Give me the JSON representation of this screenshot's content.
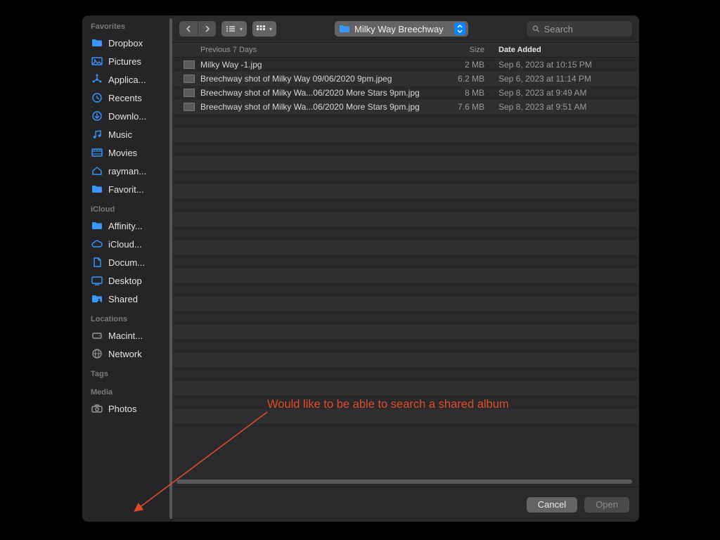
{
  "toolbar": {
    "current_folder": "Milky Way Breechway",
    "search_placeholder": "Search"
  },
  "columns": {
    "group_label": "Previous 7 Days",
    "size_label": "Size",
    "date_label": "Date Added"
  },
  "sidebar": {
    "sections": [
      {
        "title": "Favorites",
        "items": [
          {
            "icon": "folder",
            "label": "Dropbox"
          },
          {
            "icon": "picture",
            "label": "Pictures"
          },
          {
            "icon": "apps",
            "label": "Applica..."
          },
          {
            "icon": "clock",
            "label": "Recents"
          },
          {
            "icon": "download",
            "label": "Downlo..."
          },
          {
            "icon": "music",
            "label": "Music"
          },
          {
            "icon": "movie",
            "label": "Movies"
          },
          {
            "icon": "home",
            "label": "rayman..."
          },
          {
            "icon": "folder",
            "label": "Favorit..."
          }
        ]
      },
      {
        "title": "iCloud",
        "items": [
          {
            "icon": "folder",
            "label": "Affinity..."
          },
          {
            "icon": "cloud",
            "label": "iCloud..."
          },
          {
            "icon": "doc",
            "label": "Docum..."
          },
          {
            "icon": "desktop",
            "label": "Desktop"
          },
          {
            "icon": "shared",
            "label": "Shared"
          }
        ]
      },
      {
        "title": "Locations",
        "items": [
          {
            "icon": "disk",
            "label": "Macint...",
            "gray": true
          },
          {
            "icon": "globe",
            "label": "Network",
            "gray": true
          }
        ]
      },
      {
        "title": "Tags",
        "items": []
      },
      {
        "title": "Media",
        "items": [
          {
            "icon": "camera",
            "label": "Photos",
            "gray": true
          }
        ]
      }
    ]
  },
  "files": [
    {
      "name": "Milky Way -1.jpg",
      "size": "2 MB",
      "date": "Sep 6, 2023 at 10:15 PM"
    },
    {
      "name": "Breechway shot of Milky Way 09/06/2020 9pm.jpeg",
      "size": "6.2 MB",
      "date": "Sep 6, 2023 at 11:14 PM"
    },
    {
      "name": "Breechway shot of Milky Wa...06/2020 More Stars 9pm.jpg",
      "size": "8 MB",
      "date": "Sep 8, 2023 at 9:49 AM"
    },
    {
      "name": "Breechway shot of Milky Wa...06/2020 More Stars 9pm.jpg",
      "size": "7.6 MB",
      "date": "Sep 8, 2023 at 9:51 AM"
    }
  ],
  "footer": {
    "cancel_label": "Cancel",
    "open_label": "Open"
  },
  "annotation": {
    "text": "Would like to be able to search a shared album"
  },
  "colors": {
    "accent_blue": "#0a84ff",
    "icon_blue": "#3698fd",
    "annotation_red": "#e04b2a"
  }
}
